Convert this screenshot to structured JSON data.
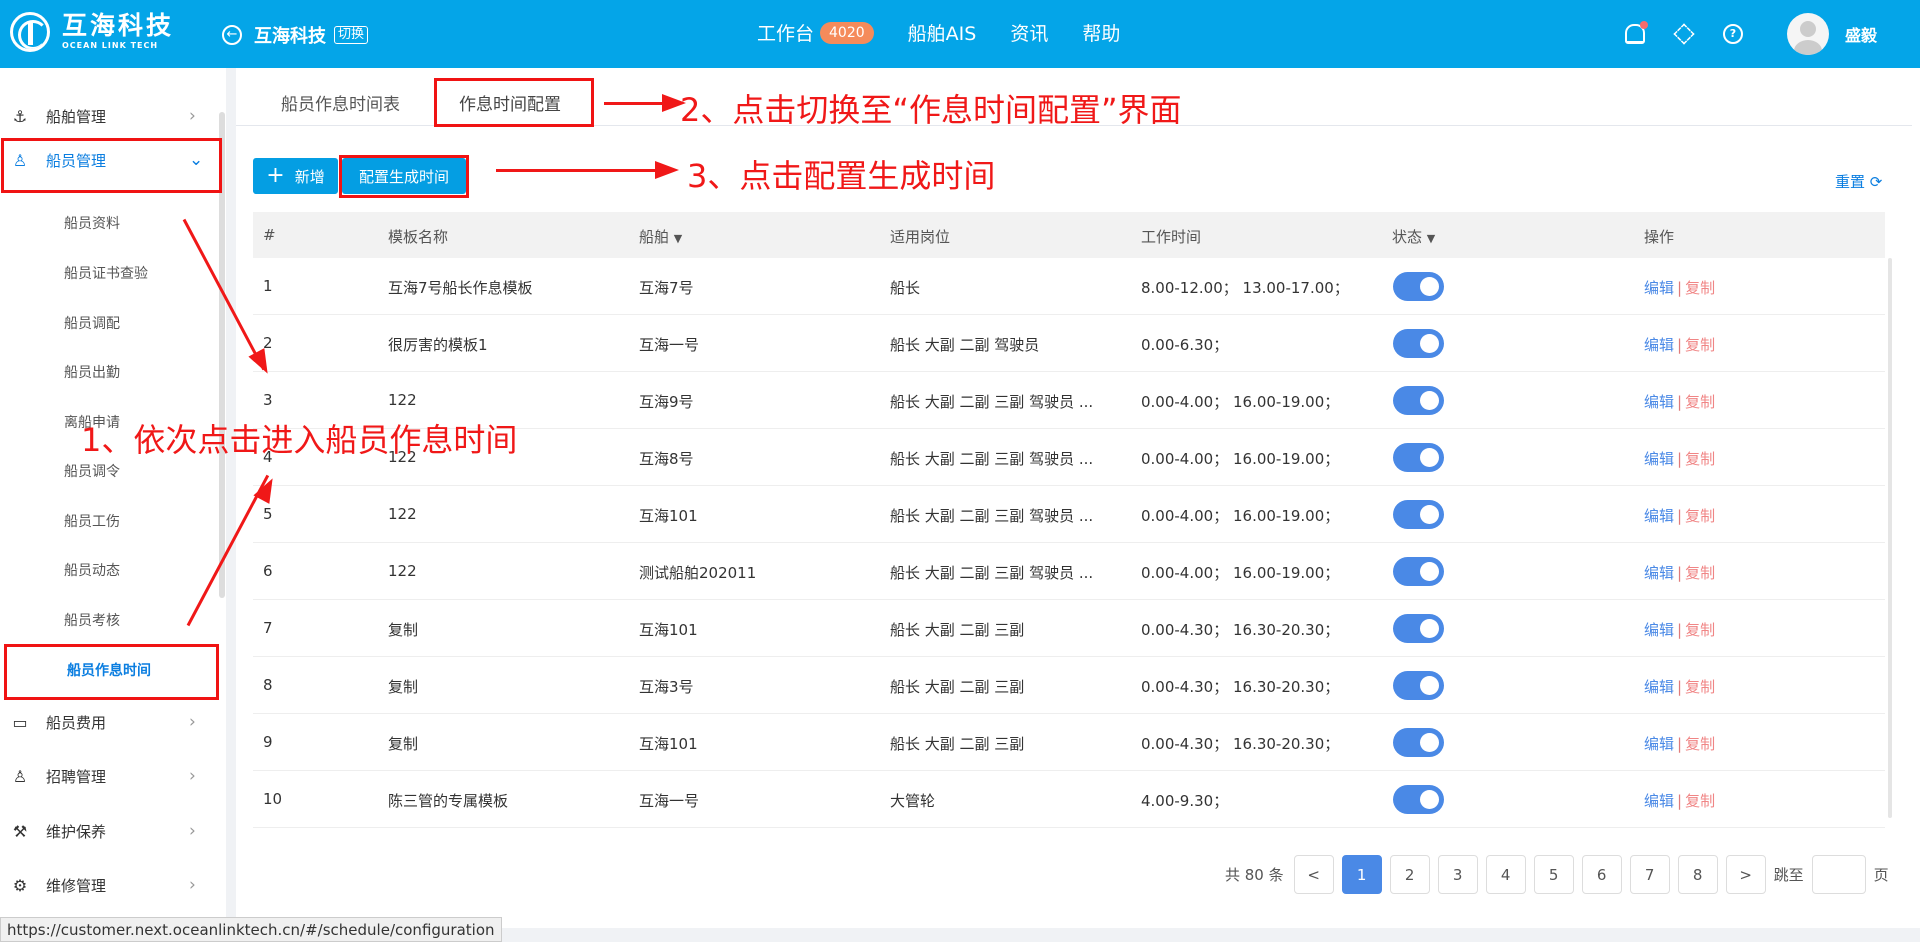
{
  "topbar": {
    "logo_cn": "互海科技",
    "logo_en": "OCEAN LINK TECH",
    "company": "互海科技",
    "switch_label": "切换",
    "nav": [
      {
        "label": "工作台",
        "badge": "4020"
      },
      {
        "label": "船舶AIS"
      },
      {
        "label": "资讯"
      },
      {
        "label": "帮助"
      }
    ],
    "username": "盛毅"
  },
  "sidebar": {
    "menus": [
      {
        "label": "船舶管理",
        "icon": "anchor-icon"
      },
      {
        "label": "船员管理",
        "icon": "person-icon"
      },
      {
        "label": "船员费用",
        "icon": "wallet-icon"
      },
      {
        "label": "招聘管理",
        "icon": "recruit-icon"
      },
      {
        "label": "维护保养",
        "icon": "hammer-icon"
      },
      {
        "label": "维修管理",
        "icon": "wrench-icon"
      }
    ],
    "submenus": [
      "船员资料",
      "船员证书查验",
      "船员调配",
      "船员出勤",
      "离船申请",
      "船员调令",
      "船员工伤",
      "船员动态",
      "船员考核",
      "船员作息时间"
    ]
  },
  "tabs": [
    "船员作息时间表",
    "作息时间配置"
  ],
  "toolbar": {
    "add_label": "新增",
    "config_label": "配置生成时间",
    "reset_label": "重置"
  },
  "table": {
    "headers": [
      "#",
      "模板名称",
      "船舶",
      "适用岗位",
      "工作时间",
      "状态",
      "操作"
    ],
    "rows": [
      [
        "1",
        "互海7号船长作息模板",
        "互海7号",
        "船长",
        "8.00-12.00；   13.00-17.00；"
      ],
      [
        "2",
        "很厉害的模板1",
        "互海一号",
        "船长 大副 二副 驾驶员",
        "0.00-6.30；"
      ],
      [
        "3",
        "122",
        "互海9号",
        "船长 大副 二副 三副 驾驶员 ...",
        "0.00-4.00；   16.00-19.00；"
      ],
      [
        "4",
        "122",
        "互海8号",
        "船长 大副 二副 三副 驾驶员 ...",
        "0.00-4.00；   16.00-19.00；"
      ],
      [
        "5",
        "122",
        "互海101",
        "船长 大副 二副 三副 驾驶员 ...",
        "0.00-4.00；   16.00-19.00；"
      ],
      [
        "6",
        "122",
        "测试船舶202011",
        "船长 大副 二副 三副 驾驶员 ...",
        "0.00-4.00；   16.00-19.00；"
      ],
      [
        "7",
        "复制",
        "互海101",
        "船长 大副 二副 三副",
        "0.00-4.30；   16.30-20.30；"
      ],
      [
        "8",
        "复制",
        "互海3号",
        "船长 大副 二副 三副",
        "0.00-4.30；   16.30-20.30；"
      ],
      [
        "9",
        "复制",
        "互海101",
        "船长 大副 二副 三副",
        "0.00-4.30；   16.30-20.30；"
      ],
      [
        "10",
        "陈三管的专属模板",
        "互海一号",
        "大管轮",
        "4.00-9.30；"
      ]
    ],
    "edit_label": "编辑",
    "copy_label": "复制",
    "sep": "|"
  },
  "pagination": {
    "total": "共 80 条",
    "pages": [
      "1",
      "2",
      "3",
      "4",
      "5",
      "6",
      "7",
      "8"
    ],
    "prev": "<",
    "next": ">",
    "jump_prefix": "跳至",
    "jump_suffix": "页"
  },
  "status_url": "https://customer.next.oceanlinktech.cn/#/schedule/configuration",
  "annotations": {
    "step1": "1、依次点击进入船员作息时间",
    "step2": "2、点击切换至“作息时间配置”界面",
    "step3": "3、点击配置生成时间"
  },
  "colors": {
    "topbar": "#04a5e8",
    "accent": "#4a89e6",
    "annotation_red": "#f01818"
  }
}
